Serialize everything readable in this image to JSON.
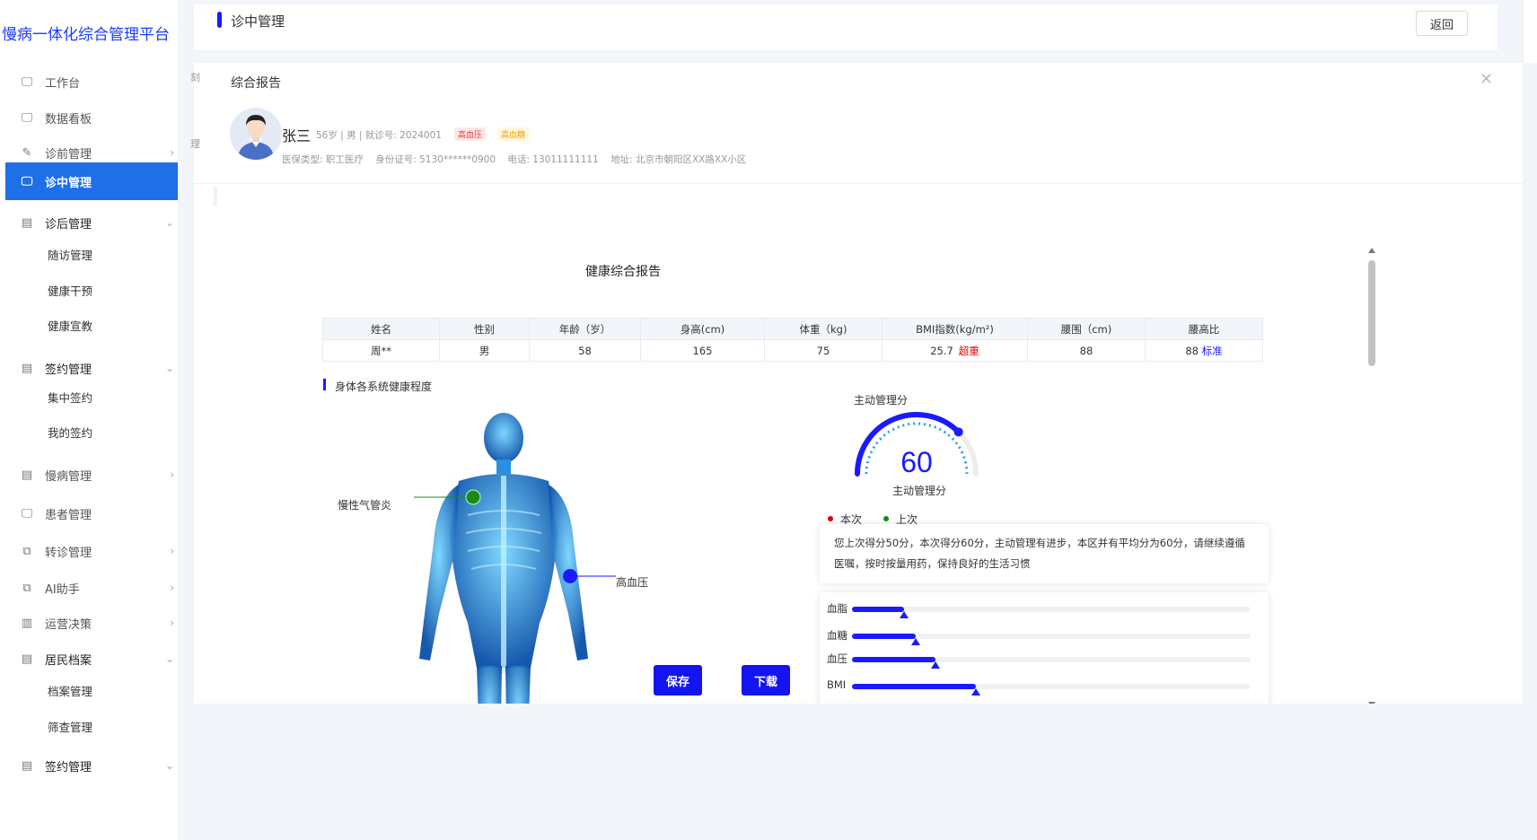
{
  "app": {
    "title": "慢病一体化综合管理平台"
  },
  "sidebar": {
    "items": [
      {
        "label": "工作台",
        "icon": "monitor-icon"
      },
      {
        "label": "数据看板",
        "icon": "monitor-icon"
      },
      {
        "label": "诊前管理",
        "icon": "edit-icon"
      },
      {
        "label": "诊中管理",
        "icon": "monitor-icon",
        "active": true
      },
      {
        "label": "诊后管理",
        "icon": "form-icon"
      },
      {
        "label": "签约管理",
        "icon": "form-icon"
      },
      {
        "label": "慢病管理",
        "icon": "form-icon"
      },
      {
        "label": "患者管理",
        "icon": "monitor-icon"
      },
      {
        "label": "转诊管理",
        "icon": "copy-icon"
      },
      {
        "label": "AI助手",
        "icon": "copy-icon"
      },
      {
        "label": "运营决策",
        "icon": "bar-chart-icon"
      },
      {
        "label": "居民档案",
        "icon": "form-icon"
      },
      {
        "label": "签约管理",
        "icon": "form-icon"
      }
    ],
    "sub_items": {
      "post_diagnosis": [
        "随访管理",
        "健康干预",
        "健康宣教"
      ],
      "signing": [
        "集中签约",
        "我的签约"
      ],
      "resident_records": [
        "档案管理",
        "筛查管理"
      ]
    }
  },
  "header": {
    "title": "诊中管理",
    "back_label": "返回"
  },
  "modal": {
    "title": "综合报告",
    "ghost_left_1": "刻",
    "ghost_left_2": "理",
    "patient": {
      "name": "张三",
      "meta": "56岁 | 男 | 就诊号: 2024001",
      "tags": [
        "高血压",
        "高血糖"
      ],
      "insurance": "医保类型: 职工医疗",
      "id_number": "身份证号: 5130******0900",
      "phone": "电话: 13011111111",
      "address": "地址: 北京市朝阳区XX路XX小区"
    }
  },
  "report": {
    "title": "健康综合报告",
    "table": {
      "headers": [
        "姓名",
        "性别",
        "年龄（岁）",
        "身高(cm)",
        "体重（kg)",
        "BMI指数(kg/m²)",
        "腰围（cm)",
        "腰高比"
      ],
      "row": [
        "周**",
        "男",
        "58",
        "165",
        "75",
        "25.7",
        "88",
        "88"
      ],
      "bmi_flag": "超重",
      "ratio_flag": "标准"
    },
    "body_section_title": "身体各系统健康程度",
    "body_labels": {
      "copd": "慢性气管炎",
      "hypertension": "高血压"
    },
    "gauge": {
      "label_top": "主动管理分",
      "label_bottom": "主动管理分",
      "value": "60",
      "value_num": 60,
      "max": 100
    },
    "legend": {
      "current": "本次",
      "previous": "上次",
      "current_color": "#e00000",
      "previous_color": "#1a8a1a"
    },
    "comment": "您上次得分50分，本次得分60分，主动管理有进步，本区并有平均分为60分，请继续遵循医嘱，按时按量用药，保持良好的生活习惯",
    "bars": [
      {
        "label": "血脂",
        "value": 0.13
      },
      {
        "label": "血糖",
        "value": 0.16
      },
      {
        "label": "血压",
        "value": 0.21
      },
      {
        "label": "BMI",
        "value": 0.31
      }
    ]
  },
  "actions": {
    "save_label": "保存",
    "download_label": "下载"
  },
  "colors": {
    "accent": "#1a1aff",
    "active_nav": "#1e6fe8",
    "brand": "#1a3bff"
  }
}
